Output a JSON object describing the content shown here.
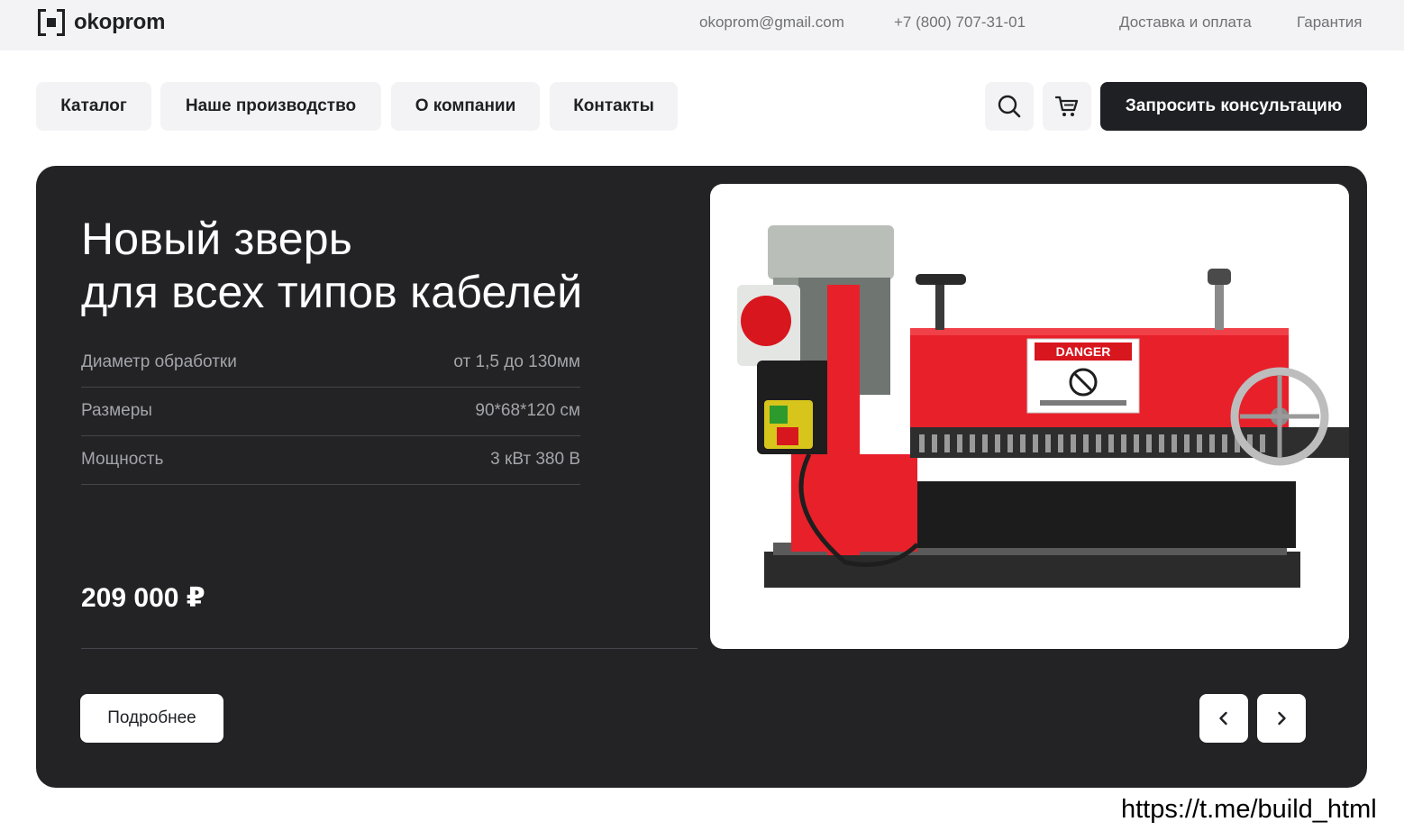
{
  "brand": {
    "name": "okoprom"
  },
  "topbar": {
    "email": "okoprom@gmail.com",
    "phone": "+7 (800) 707-31-01",
    "delivery": "Доставка и оплата",
    "warranty": "Гарантия"
  },
  "nav": {
    "items": [
      "Каталог",
      "Наше производство",
      "О компании",
      "Контакты"
    ],
    "cta": "Запросить консультацию",
    "icons": [
      "search-icon",
      "cart-icon"
    ]
  },
  "hero": {
    "title_line1": "Новый зверь",
    "title_line2": "для всех типов кабелей",
    "specs": [
      {
        "label": "Диаметр обработки",
        "value": "от 1,5 до 130мм"
      },
      {
        "label": "Размеры",
        "value": "90*68*120 см"
      },
      {
        "label": "Мощность",
        "value": "3 кВт 380 В"
      }
    ],
    "price": "209 000 ₽",
    "more_label": "Подробнее",
    "image_label": "DANGER"
  },
  "watermark": "https://t.me/build_html",
  "colors": {
    "dark": "#232326",
    "light": "#f3f3f5",
    "accent_red": "#e8202a"
  }
}
